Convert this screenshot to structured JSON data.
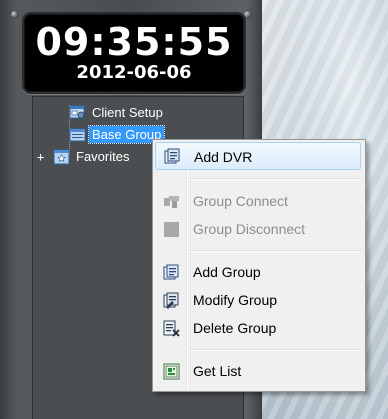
{
  "clock": {
    "time": "09:35:55",
    "date": "2012-06-06"
  },
  "tree": {
    "items": [
      {
        "label": "Client Setup",
        "icon": "client-setup-icon"
      },
      {
        "label": "Base Group",
        "icon": "group-folder-icon",
        "selected": true
      },
      {
        "label": "Favorites",
        "icon": "favorites-icon",
        "expander": "+"
      }
    ]
  },
  "context_menu": {
    "items": [
      {
        "label": "Add DVR",
        "icon": "add-dvr-icon",
        "enabled": true,
        "highlighted": true
      },
      {
        "label": "Group Connect",
        "icon": "group-connect-icon",
        "enabled": false
      },
      {
        "label": "Group Disconnect",
        "icon": "group-disconnect-icon",
        "enabled": false
      },
      {
        "label": "Add Group",
        "icon": "add-group-icon",
        "enabled": true
      },
      {
        "label": "Modify Group",
        "icon": "modify-group-icon",
        "enabled": true
      },
      {
        "label": "Delete Group",
        "icon": "delete-group-icon",
        "enabled": true
      },
      {
        "label": "Get List",
        "icon": "get-list-icon",
        "enabled": true
      }
    ]
  },
  "colors": {
    "selection": "#3399ff",
    "menu_background": "#f0f0f0",
    "menu_hover": "#dcecfb",
    "disabled_text": "#8d8d8d",
    "clock_background": "#000000",
    "panel": "#4b4e51"
  }
}
